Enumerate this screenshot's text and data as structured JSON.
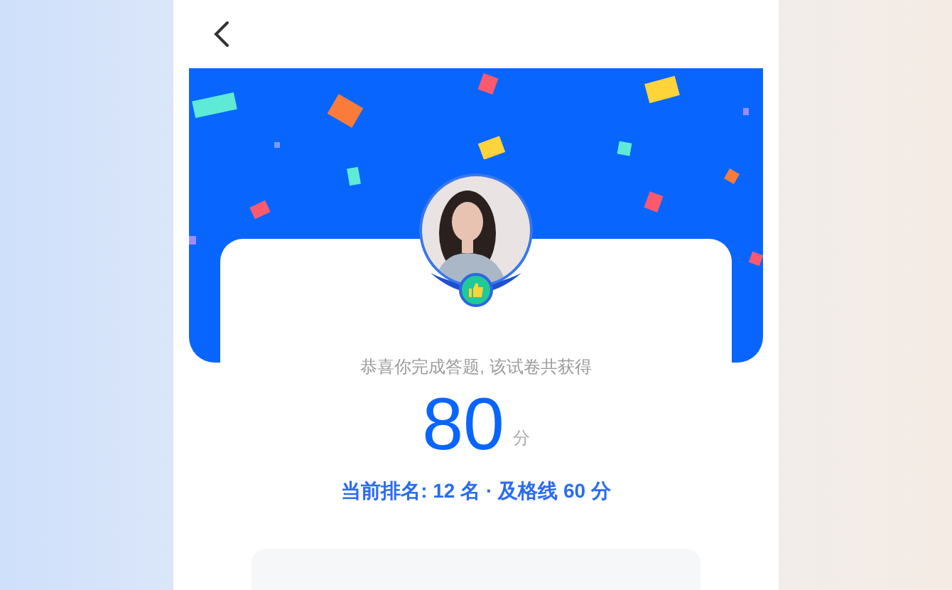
{
  "result": {
    "message": "恭喜你完成答题, 该试卷共获得",
    "score": "80",
    "score_unit": "分",
    "rank_line": "当前排名: 12 名 · 及格线 60 分"
  }
}
